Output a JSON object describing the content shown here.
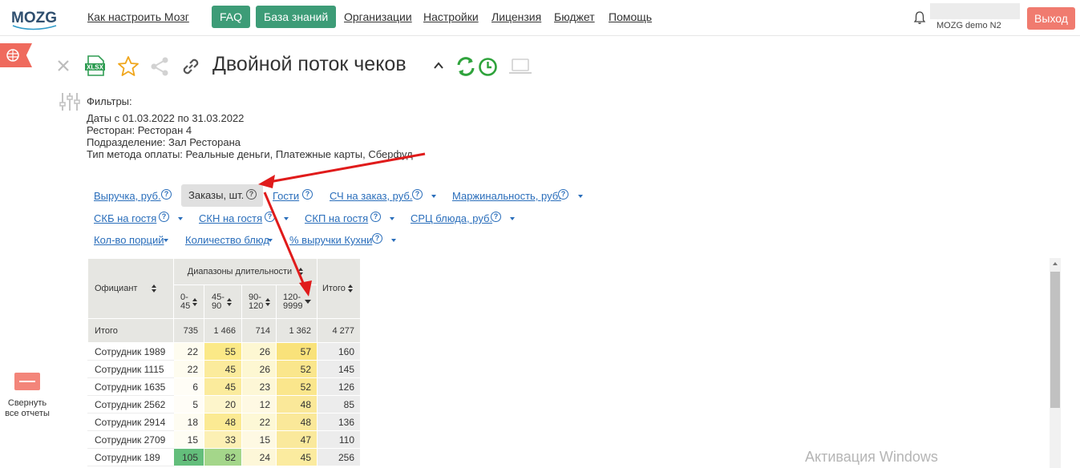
{
  "app": {
    "logo_text": "MOZG"
  },
  "nav": {
    "links": [
      "Как настроить Мозг",
      "Организации",
      "Настройки",
      "Лицензия",
      "Бюджет",
      "Помощь"
    ],
    "buttons": [
      "FAQ",
      "База знаний"
    ],
    "user_name": "MOZG demo N2",
    "logout_label": "Выход"
  },
  "report": {
    "title": "Двойной поток чеков",
    "icons": [
      "close-icon",
      "xlsx-export-icon",
      "star-icon",
      "share-icon",
      "link-icon",
      "chevron-up-icon",
      "refresh-icon",
      "clock-icon",
      "laptop-icon"
    ],
    "xlsx_label": "XLSX"
  },
  "filters": {
    "heading": "Фильтры:",
    "dates_label": "Даты",
    "dates_value": "с 01.03.2022 по 31.03.2022",
    "restaurant_label": "Ресторан:",
    "restaurant_value": "Ресторан 4",
    "division_label": "Подразделение:",
    "division_value": "Зал Ресторана",
    "payment_label": "Тип метода оплаты:",
    "payment_value": "Реальные деньги, Платежные карты, Сберфуд"
  },
  "metrics": {
    "revenue": "Выручка, руб.",
    "orders": "Заказы, шт.",
    "guests": "Гости",
    "avg_check": "СЧ на заказ, руб.",
    "margin": "Маржинальность, руб.",
    "skb": "СКБ на гостя",
    "skn": "СКН на гостя",
    "skp": "СКП на гостя",
    "src": "СРЦ блюда, руб.",
    "portions": "Кол-во порций",
    "dishes": "Количество блюд",
    "kitchen_share": "% выручки Кухни",
    "help_glyph": "?"
  },
  "table": {
    "col_waiter": "Официант",
    "col_group": "Диапазоны длительности",
    "ranges": [
      [
        "0-",
        "45"
      ],
      [
        "45-",
        "90"
      ],
      [
        "90-",
        "120"
      ],
      [
        "120-",
        "9999"
      ]
    ],
    "col_total": "Итого",
    "total_row": {
      "label": "Итого",
      "values": [
        "735",
        "1 466",
        "714",
        "1 362"
      ],
      "total": "4 277"
    },
    "rows": [
      {
        "name": "Сотрудник 1989",
        "values": [
          "22",
          "55",
          "26",
          "57"
        ],
        "total": "160"
      },
      {
        "name": "Сотрудник 1115",
        "values": [
          "22",
          "45",
          "26",
          "52"
        ],
        "total": "145"
      },
      {
        "name": "Сотрудник 1635",
        "values": [
          "6",
          "45",
          "23",
          "52"
        ],
        "total": "126"
      },
      {
        "name": "Сотрудник 2562",
        "values": [
          "5",
          "20",
          "12",
          "48"
        ],
        "total": "85"
      },
      {
        "name": "Сотрудник 2914",
        "values": [
          "18",
          "48",
          "22",
          "48"
        ],
        "total": "136"
      },
      {
        "name": "Сотрудник 2709",
        "values": [
          "15",
          "33",
          "15",
          "47"
        ],
        "total": "110"
      },
      {
        "name": "Сотрудник 189",
        "values": [
          "105",
          "82",
          "24",
          "45"
        ],
        "total": "256"
      }
    ],
    "cell_colors": [
      [
        "#fefcef",
        "#fbe987",
        "#fdf7d2",
        "#f9e27a"
      ],
      [
        "#fefcef",
        "#fbeb9c",
        "#fdf7d2",
        "#fae68c"
      ],
      [
        "#fffdf6",
        "#fbeb9c",
        "#fdf7d6",
        "#fae68c"
      ],
      [
        "#fffdf7",
        "#fdf5cb",
        "#fef9e3",
        "#fae899"
      ],
      [
        "#fefcf1",
        "#fbea93",
        "#fdf8d6",
        "#fae899"
      ],
      [
        "#fefdf3",
        "#fcf0b4",
        "#fef9e3",
        "#fae99c"
      ],
      [
        "#63be7b",
        "#a4d68a",
        "#fdf7d8",
        "#fbeb9f"
      ]
    ]
  },
  "side": {
    "collapse_label": "Свернуть все отчеты"
  },
  "watermark": "Активация Windows"
}
